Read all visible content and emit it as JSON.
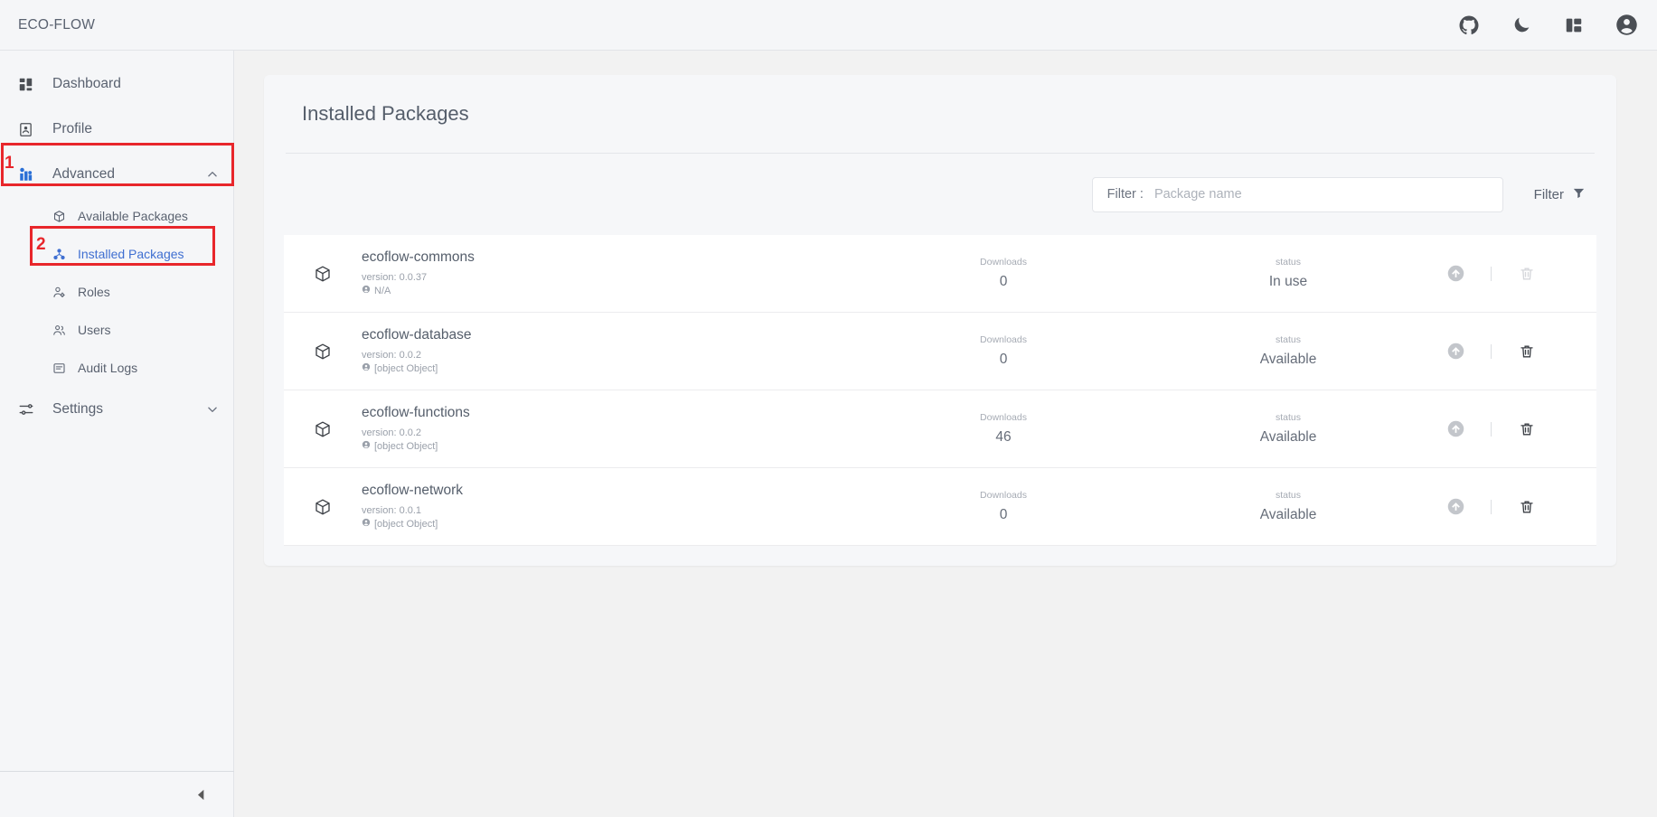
{
  "topbar": {
    "brand": "ECO-FLOW",
    "actions": [
      {
        "name": "github-icon",
        "label": "GitHub"
      },
      {
        "name": "dark-mode-icon",
        "label": "Dark mode"
      },
      {
        "name": "layout-icon",
        "label": "Layout"
      },
      {
        "name": "account-icon",
        "label": "Account"
      }
    ]
  },
  "sidebar": {
    "items": [
      {
        "label": "Dashboard",
        "icon": "dashboard-icon"
      },
      {
        "label": "Profile",
        "icon": "profile-icon"
      },
      {
        "label": "Advanced",
        "icon": "advanced-icon",
        "chevron": "chevron-up"
      },
      {
        "label": "Settings",
        "icon": "settings-icon",
        "chevron": "chevron-down"
      }
    ],
    "advanced_children": [
      {
        "label": "Available Packages",
        "icon": "available-packages-icon",
        "active": false
      },
      {
        "label": "Installed Packages",
        "icon": "installed-packages-icon",
        "active": true
      },
      {
        "label": "Roles",
        "icon": "roles-icon",
        "active": false
      },
      {
        "label": "Users",
        "icon": "users-icon",
        "active": false
      },
      {
        "label": "Audit Logs",
        "icon": "audit-logs-icon",
        "active": false
      }
    ],
    "collapse_icon": "collapse-left-icon"
  },
  "annotations": [
    {
      "number": "1",
      "target": "Advanced"
    },
    {
      "number": "2",
      "target": "Installed Packages"
    }
  ],
  "main": {
    "page_title": "Installed Packages",
    "filter": {
      "label": "Filter :",
      "placeholder": "Package name",
      "value": "",
      "button_label": "Filter",
      "button_icon": "funnel-icon"
    },
    "columns": {
      "downloads": "Downloads",
      "status": "status"
    },
    "packages": [
      {
        "name": "ecoflow-commons",
        "version": "version: 0.0.37",
        "author": "N/A",
        "downloads": "0",
        "status": "In use",
        "upgrade_enabled": false,
        "delete_enabled": false
      },
      {
        "name": "ecoflow-database",
        "version": "version: 0.0.2",
        "author": "[object Object]",
        "downloads": "0",
        "status": "Available",
        "upgrade_enabled": false,
        "delete_enabled": true
      },
      {
        "name": "ecoflow-functions",
        "version": "version: 0.0.2",
        "author": "[object Object]",
        "downloads": "46",
        "status": "Available",
        "upgrade_enabled": false,
        "delete_enabled": true
      },
      {
        "name": "ecoflow-network",
        "version": "version: 0.0.1",
        "author": "[object Object]",
        "downloads": "0",
        "status": "Available",
        "upgrade_enabled": false,
        "delete_enabled": true
      }
    ]
  },
  "colors": {
    "accent_blue": "#3f6fd1",
    "annotation_red": "#e8262b",
    "text_primary": "#555e6b",
    "text_muted": "#9aa0aa",
    "sidebar_bg": "#f5f6f8",
    "page_bg": "#f2f2f2"
  }
}
